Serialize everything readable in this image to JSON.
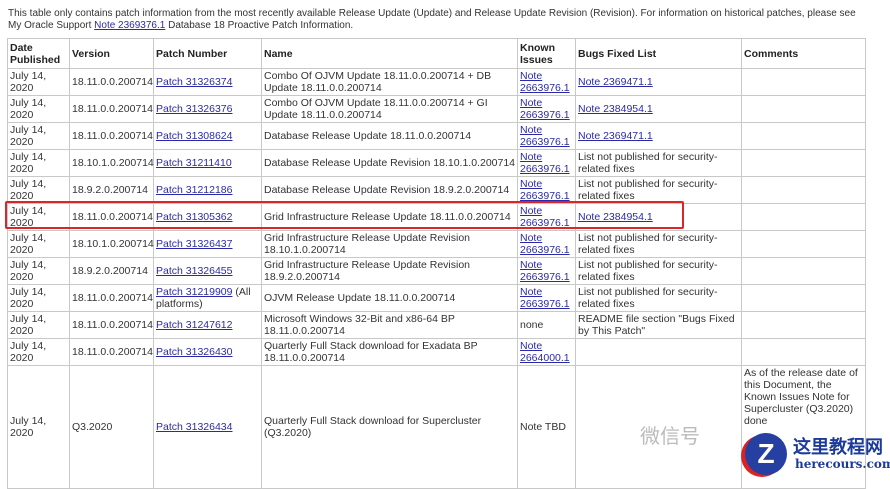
{
  "intro": {
    "text_before": "This table only contains patch information from the most recently available Release Update (Update) and Release Update Revision (Revision). For information on historical patches, please see My Oracle Support ",
    "link": "Note 2369376.1",
    "text_after": " Database 18 Proactive Patch Information."
  },
  "headers": [
    "Date Published",
    "Version",
    "Patch Number",
    "Name",
    "Known Issues",
    "Bugs Fixed List",
    "Comments"
  ],
  "rows": [
    {
      "date": "July 14, 2020",
      "version": "18.11.0.0.200714",
      "patch": "Patch 31326374",
      "patch_extra": "",
      "name": "Combo Of OJVM Update 18.11.0.0.200714 + DB Update 18.11.0.0.200714",
      "known": "Note 2663976.1",
      "known_link": true,
      "bugs": "Note 2369471.1",
      "bugs_link": true,
      "comments": ""
    },
    {
      "date": "July 14, 2020",
      "version": "18.11.0.0.200714",
      "patch": "Patch 31326376",
      "patch_extra": "",
      "name": "Combo Of OJVM Update 18.11.0.0.200714 + GI Update 18.11.0.0.200714",
      "known": "Note 2663976.1",
      "known_link": true,
      "bugs": "Note 2384954.1",
      "bugs_link": true,
      "comments": ""
    },
    {
      "date": "July 14, 2020",
      "version": "18.11.0.0.200714",
      "patch": "Patch 31308624",
      "patch_extra": "",
      "name": "Database Release Update 18.11.0.0.200714",
      "known": "Note 2663976.1",
      "known_link": true,
      "bugs": "Note 2369471.1",
      "bugs_link": true,
      "comments": ""
    },
    {
      "date": "July 14, 2020",
      "version": "18.10.1.0.200714",
      "patch": "Patch 31211410",
      "patch_extra": "",
      "name": "Database Release Update Revision 18.10.1.0.200714",
      "known": "Note 2663976.1",
      "known_link": true,
      "bugs": "List not published for security-related fixes",
      "bugs_link": false,
      "comments": ""
    },
    {
      "date": "July 14, 2020",
      "version": "18.9.2.0.200714",
      "patch": "Patch 31212186",
      "patch_extra": "",
      "name": "Database Release Update Revision 18.9.2.0.200714",
      "known": "Note 2663976.1",
      "known_link": true,
      "bugs": "List not published for security-related fixes",
      "bugs_link": false,
      "comments": ""
    },
    {
      "date": "July 14, 2020",
      "version": "18.11.0.0.200714",
      "patch": "Patch 31305362",
      "patch_extra": "",
      "name": "Grid Infrastructure Release Update 18.11.0.0.200714",
      "known": "Note 2663976.1",
      "known_link": true,
      "bugs": "Note 2384954.1",
      "bugs_link": true,
      "comments": "",
      "highlighted": true
    },
    {
      "date": "July 14, 2020",
      "version": "18.10.1.0.200714",
      "patch": "Patch 31326437",
      "patch_extra": "",
      "name": "Grid Infrastructure Release Update Revision 18.10.1.0.200714",
      "known": "Note 2663976.1",
      "known_link": true,
      "bugs": "List not published for security-related fixes",
      "bugs_link": false,
      "comments": ""
    },
    {
      "date": "July 14, 2020",
      "version": "18.9.2.0.200714",
      "patch": "Patch 31326455",
      "patch_extra": "",
      "name": "Grid Infrastructure Release Update Revision 18.9.2.0.200714",
      "known": "Note 2663976.1",
      "known_link": true,
      "bugs": "List not published for security-related fixes",
      "bugs_link": false,
      "comments": ""
    },
    {
      "date": "July 14, 2020",
      "version": "18.11.0.0.200714",
      "patch": "Patch 31219909",
      "patch_extra": " (All platforms)",
      "name": "OJVM Release Update 18.11.0.0.200714",
      "known": "Note 2663976.1",
      "known_link": true,
      "bugs": "List not published for security-related fixes",
      "bugs_link": false,
      "comments": ""
    },
    {
      "date": "July 14, 2020",
      "version": "18.11.0.0.200714",
      "patch": "Patch 31247612",
      "patch_extra": "",
      "name": "Microsoft Windows 32-Bit and x86-64 BP 18.11.0.0.200714",
      "known": "none",
      "known_link": false,
      "bugs": "README file section \"Bugs Fixed by This Patch\"",
      "bugs_link": false,
      "comments": ""
    },
    {
      "date": "July 14, 2020",
      "version": "18.11.0.0.200714",
      "patch": "Patch 31326430",
      "patch_extra": "",
      "name": "Quarterly Full Stack download for Exadata BP 18.11.0.0.200714",
      "known": "Note 2664000.1",
      "known_link": true,
      "bugs": "",
      "bugs_link": false,
      "comments": ""
    },
    {
      "date": "July 14, 2020",
      "version": "Q3.2020",
      "patch": "Patch 31326434",
      "patch_extra": "",
      "name": "Quarterly Full Stack download for Supercluster (Q3.2020)",
      "known": "Note TBD",
      "known_link": false,
      "bugs": "",
      "bugs_link": false,
      "comments": "As of the release date of this Document, the Known Issues Note for Supercluster (Q3.2020) done"
    }
  ],
  "watermark": {
    "wechat": "微信号",
    "logo_title": "这里教程网",
    "logo_url": "herecours.com",
    "logo_letter": "Z"
  }
}
